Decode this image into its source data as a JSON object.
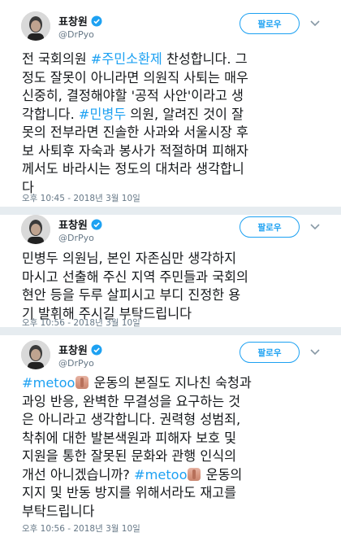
{
  "follow_label": "팔로우",
  "tweets": [
    {
      "name": "표창원",
      "handle": "@DrPyo",
      "lines": [
        [
          {
            "t": "전 국회의원 "
          },
          {
            "t": "#주민소환제",
            "h": 1
          },
          {
            "t": " 찬성합니다. 그"
          }
        ],
        [
          {
            "t": "정도 잘못이 아니라면 의원직 사퇴는 매우"
          }
        ],
        [
          {
            "t": "신중히, 결정해야할 '공적 사안'이라고 생"
          }
        ],
        [
          {
            "t": "각합니다. "
          },
          {
            "t": "#민병두",
            "h": 1
          },
          {
            "t": " 의원, 알려진 것이 잘"
          }
        ],
        [
          {
            "t": "못의 전부라면 진솔한 사과와 서울시장 후"
          }
        ],
        [
          {
            "t": "보 사퇴후 자숙과 봉사가 적절하며 피해자"
          }
        ],
        [
          {
            "t": "께서도 바라시는 정도의 대처라 생각합니"
          }
        ],
        [
          {
            "t": "다"
          }
        ]
      ],
      "time": "오후 10:45 - 2018년 3월 10일"
    },
    {
      "name": "표창원",
      "handle": "@DrPyo",
      "lines": [
        [
          {
            "t": "민병두 의원님, 본인 자존심만 생각하지"
          }
        ],
        [
          {
            "t": "마시고 선출해 주신 지역 주민들과 국회의"
          }
        ],
        [
          {
            "t": "현안 등을 두루 살피시고 부디 진정한 용"
          }
        ],
        [
          {
            "t": "기 발휘해 주시길 부탁드립니다"
          }
        ]
      ],
      "time": "오후 10:56 - 2018년 3월 10일"
    },
    {
      "name": "표창원",
      "handle": "@DrPyo",
      "lines": [
        [
          {
            "t": "#metoo",
            "h": 1
          },
          {
            "e": 1
          },
          {
            "t": " 운동의 본질도 지나친 숙청과"
          }
        ],
        [
          {
            "t": "과잉 반응, 완벽한 무결성을 요구하는 것"
          }
        ],
        [
          {
            "t": "은 아니라고 생각합니다. 권력형 성범죄,"
          }
        ],
        [
          {
            "t": "착취에 대한 발본색원과 피해자 보호 및"
          }
        ],
        [
          {
            "t": "지원을 통한 잘못된 문화와 관행 인식의"
          }
        ],
        [
          {
            "t": "개선 아니겠습니까? "
          },
          {
            "t": "#metoo",
            "h": 1
          },
          {
            "e": 1
          },
          {
            "t": " 운동의"
          }
        ],
        [
          {
            "t": "지지 및 반동 방지를 위해서라도 재고를"
          }
        ],
        [
          {
            "t": "부탁드립니다"
          }
        ]
      ],
      "time": "오후 10:56 - 2018년 3월 10일"
    }
  ]
}
